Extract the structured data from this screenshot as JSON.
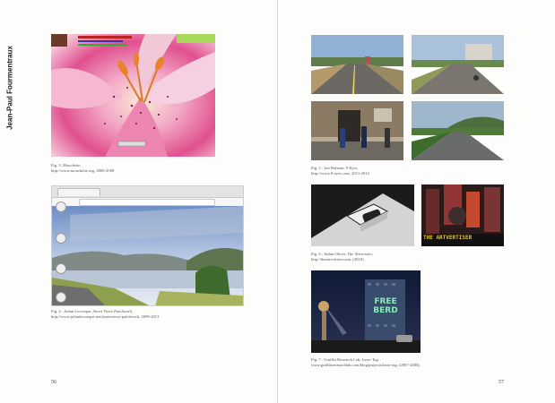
{
  "author": "Jean-Paul Fourmentraux",
  "left_page": {
    "page_number": "56",
    "figures": [
      {
        "caption_line1_prefix": "Fig. 3. ",
        "caption_line1_title": "Mouchette,",
        "caption_line2": "http://www.mouchette.org, 2000-2008"
      },
      {
        "caption_line1_prefix": "Fig. 4 : Julian Lecoeque, ",
        "caption_line1_title": "Street Views Patchwork,",
        "caption_line2": "http://www.julianlecoeque.net/streetviews-patchwork, 2009-2013"
      }
    ]
  },
  "right_page": {
    "page_number": "57",
    "figures": [
      {
        "caption_line1_prefix": "Fig. 5 : Jon Rafman, ",
        "caption_line1_title": "9-Eyes,",
        "caption_line2": "http://www.9-eyes.com, 2011-2014"
      },
      {
        "caption_line1_prefix": "Fig. 6 : Julian Oliver, ",
        "caption_line1_title": "The Artvertiser,",
        "caption_line2": "http://theartvertiser.com, (2010)"
      },
      {
        "caption_line1_prefix": "Fig. 7 : Graffiti Research Lab, ",
        "caption_line1_title": "Laser Tag",
        "caption_line2": "www.graffitiresearchlab.com/blog/projects/laser-tag, (2007-2008)"
      }
    ],
    "sign_text": "THE ARTVERTISER",
    "graffiti_text": "FREE BERD"
  }
}
